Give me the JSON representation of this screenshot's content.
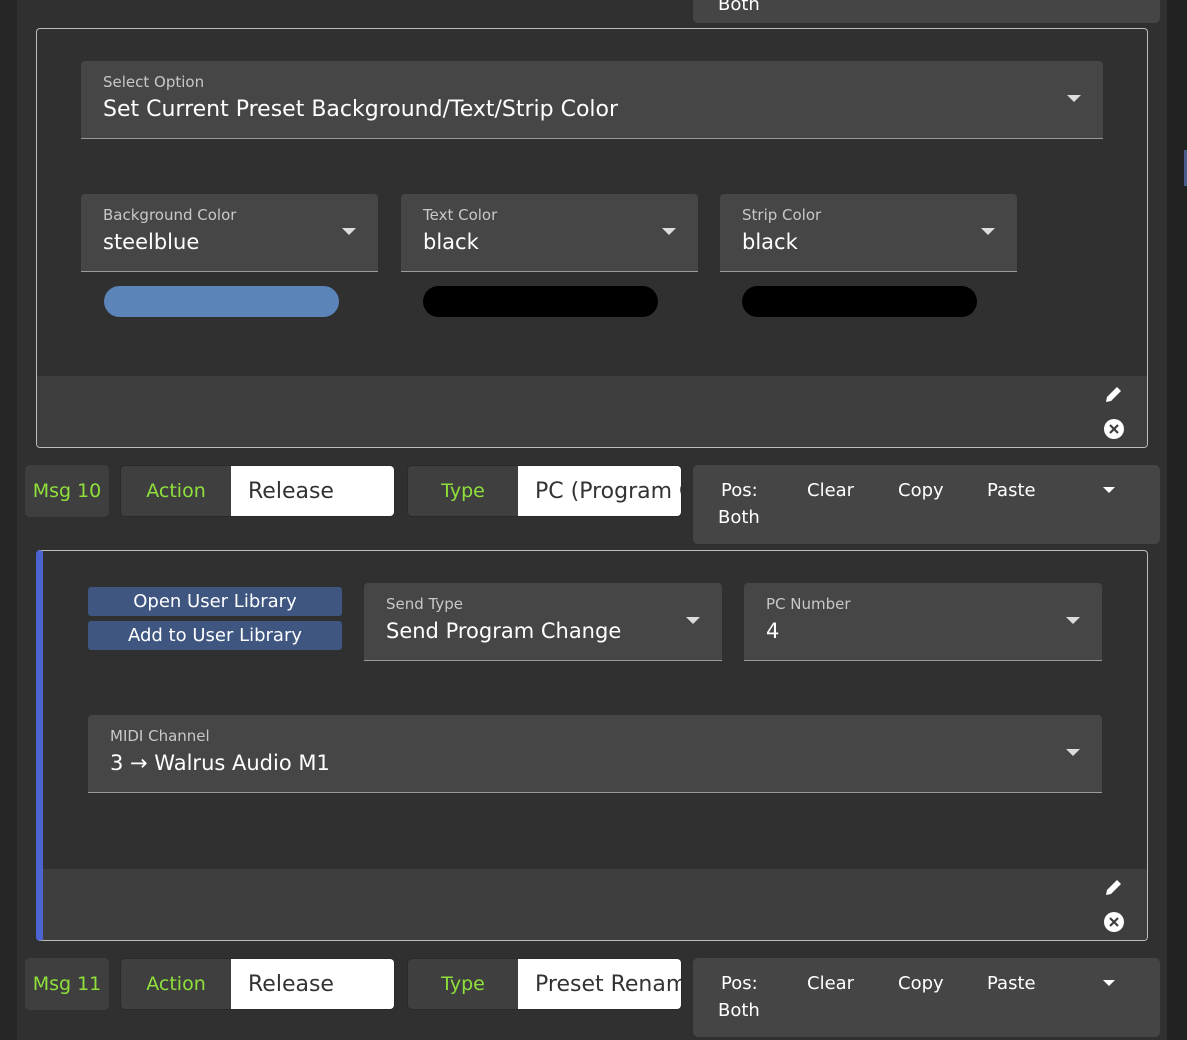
{
  "top_partial": {
    "pos_value": "Both"
  },
  "card1": {
    "select_option": {
      "label": "Select Option",
      "value": "Set Current Preset Background/Text/Strip Color"
    },
    "background_color": {
      "label": "Background Color",
      "value": "steelblue",
      "swatch": "#5b84b8"
    },
    "text_color": {
      "label": "Text Color",
      "value": "black",
      "swatch": "#000000"
    },
    "strip_color": {
      "label": "Strip Color",
      "value": "black",
      "swatch": "#000000"
    },
    "icons": [
      "pencil-icon",
      "close-circle-icon"
    ]
  },
  "msg10": {
    "msg": "Msg 10",
    "action_label": "Action",
    "action_value": "Release",
    "type_label": "Type",
    "type_value": "PC (Program Change)",
    "pos_label": "Pos:",
    "pos_value": "Both",
    "clear": "Clear",
    "copy": "Copy",
    "paste": "Paste"
  },
  "card2": {
    "open_library": "Open User Library",
    "add_library": "Add to User Library",
    "send_type": {
      "label": "Send Type",
      "value": "Send Program Change"
    },
    "pc_number": {
      "label": "PC Number",
      "value": "4"
    },
    "midi_channel": {
      "label": "MIDI Channel",
      "value": "3 → Walrus Audio M1"
    },
    "accent": "#4c63d2"
  },
  "msg11": {
    "msg": "Msg 11",
    "action_label": "Action",
    "action_value": "Release",
    "type_label": "Type",
    "type_value": "Preset Rename",
    "pos_label": "Pos:",
    "pos_value": "Both",
    "clear": "Clear",
    "copy": "Copy",
    "paste": "Paste"
  }
}
